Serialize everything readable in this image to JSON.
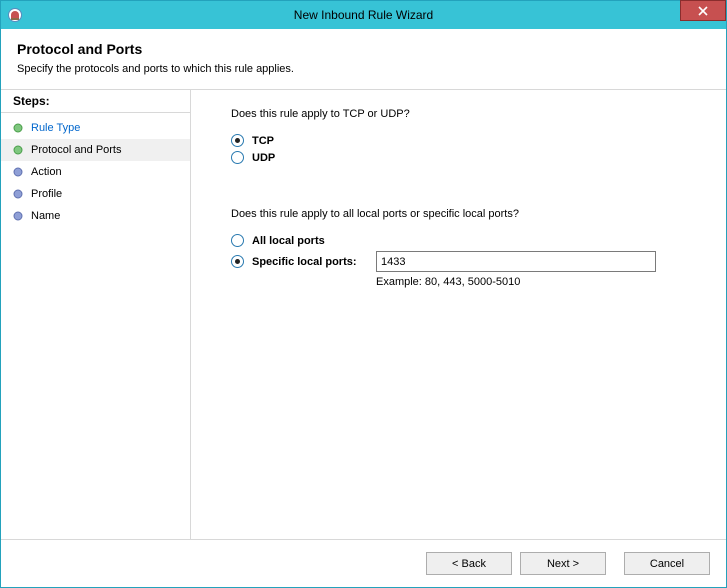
{
  "window": {
    "title": "New Inbound Rule Wizard"
  },
  "header": {
    "heading": "Protocol and Ports",
    "subtitle": "Specify the protocols and ports to which this rule applies."
  },
  "sidebar": {
    "steps_label": "Steps:",
    "steps": [
      {
        "label": "Rule Type",
        "state": "done"
      },
      {
        "label": "Protocol and Ports",
        "state": "current"
      },
      {
        "label": "Action",
        "state": "pending"
      },
      {
        "label": "Profile",
        "state": "pending"
      },
      {
        "label": "Name",
        "state": "pending"
      }
    ]
  },
  "content": {
    "protocol_question": "Does this rule apply to TCP or UDP?",
    "protocol": {
      "tcp_label": "TCP",
      "udp_label": "UDP",
      "selected": "tcp"
    },
    "ports_question": "Does this rule apply to all local ports or specific local ports?",
    "ports": {
      "all_label": "All local ports",
      "specific_label": "Specific local ports:",
      "selected": "specific",
      "value": "1433",
      "example": "Example: 80, 443, 5000-5010"
    }
  },
  "footer": {
    "back": "< Back",
    "next": "Next >",
    "cancel": "Cancel"
  }
}
